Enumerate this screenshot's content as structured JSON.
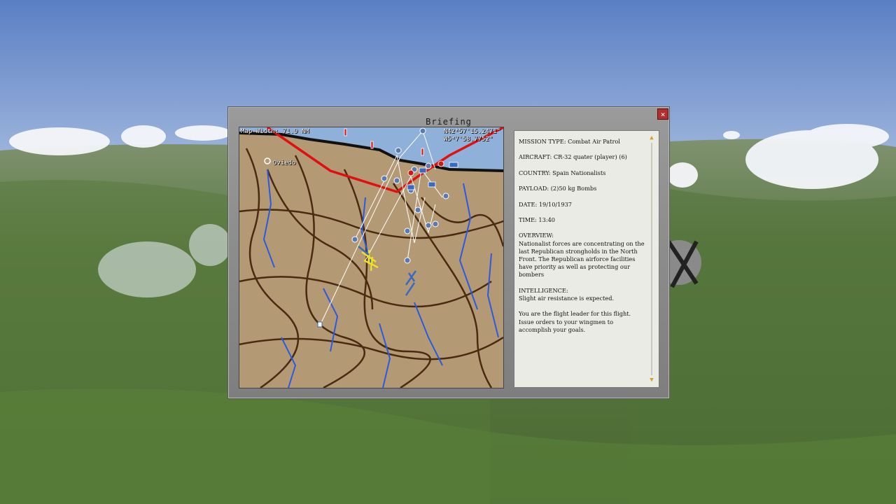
{
  "window": {
    "title": "Briefing",
    "close_icon": "×"
  },
  "map": {
    "width_label": "Map Width: 71.9  NM",
    "coord_lat": "N42*57'15.2471\"",
    "coord_lon": "W5*7'58.7752\"",
    "town": "Oviedo"
  },
  "briefing": {
    "mission_type": "MISSION TYPE: Combat Air Patrol",
    "aircraft": "AIRCRAFT: CR-32 quater (player) (6)",
    "country": "COUNTRY: Spain Nationalists",
    "payload": "PAYLOAD: (2)50 kg Bombs",
    "date": "DATE: 19/10/1937",
    "time": "TIME: 13:40",
    "overview_heading": "OVERVIEW:",
    "overview_body": "Nationalist forces are concentrating on the last Republican strongholds in the North Front.  The Republican airforce facilities have priority as well as protecting our bombers",
    "intel_heading": "INTELLIGENCE:",
    "intel_body": "Slight air resistance is expected.",
    "leader_text": "You are the flight leader for this flight.  Issue orders to your wingmen to accomplish your goals."
  },
  "scroll": {
    "up": "▲",
    "down": "▼"
  },
  "colors": {
    "sea": "#8fb0d8",
    "land": "#b49a74",
    "frontline": "#e01010",
    "rivers": "#2a5ae0",
    "roads": "#4a2a10"
  }
}
